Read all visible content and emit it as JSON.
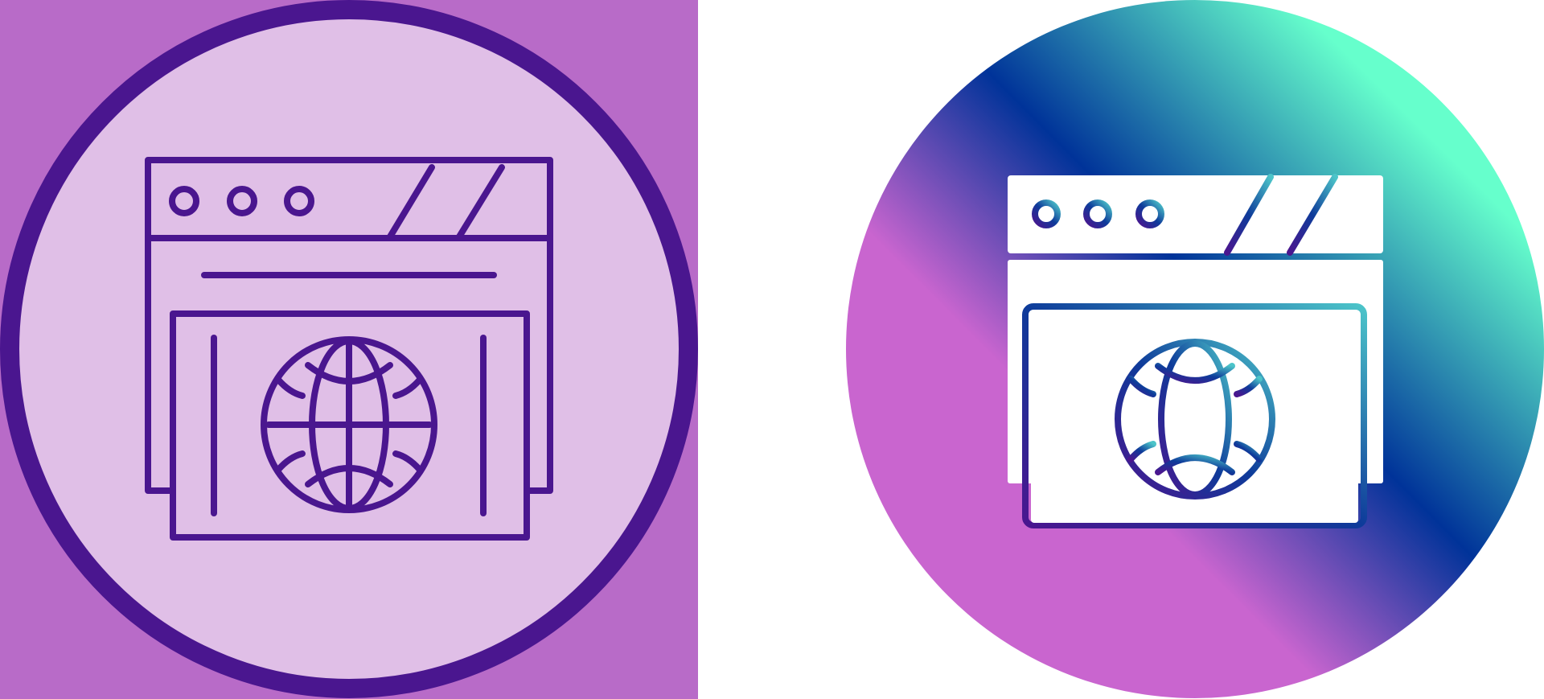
{
  "icons": [
    {
      "name": "browser-globe-icon",
      "variant": "line",
      "colors": {
        "square_background": "#b86bc8",
        "circle_fill": "#e0bfe7",
        "circle_ring": "#4a168f",
        "stroke": "#4a168f"
      }
    },
    {
      "name": "browser-globe-icon",
      "variant": "gradient",
      "colors": {
        "gradient_stops": [
          "#c965cf",
          "#003399",
          "#66ffcc"
        ],
        "glyph_fill": "#ffffff",
        "stroke_gradient": [
          "#4a168f",
          "#0e3b9a",
          "#4cc4c9"
        ]
      }
    }
  ]
}
